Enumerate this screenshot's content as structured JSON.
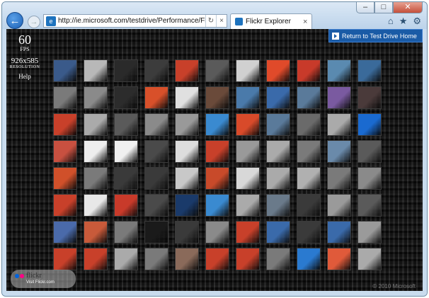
{
  "browser": {
    "address_url": "http://ie.microsoft.com/testdrive/Performance/FlickrExpl",
    "tab_title": "Flickr Explorer",
    "tab_close": "×",
    "back_glyph": "←",
    "forward_glyph": "→",
    "refresh_glyph": "↻",
    "stop_glyph": "×",
    "window_controls": {
      "minimize": "–",
      "maximize": "□",
      "close": "✕"
    },
    "toolbar_icons": [
      "home-icon",
      "favorites-star-icon",
      "tools-gear-icon"
    ],
    "toolbar_glyphs": {
      "home": "⌂",
      "star": "★",
      "gear": "⚙"
    }
  },
  "stats": {
    "fps_value": "60",
    "fps_label": "FPS",
    "resolution_value": "926x585",
    "resolution_label": "RESOLUTION",
    "help_label": "Help"
  },
  "return_button": {
    "label": "Return to Test Drive Home"
  },
  "footer": {
    "logo_text": "flickr",
    "visit_text": "Visit Flickr.com",
    "copyright": "© 2010 Microsoft"
  },
  "colors": {
    "accent_blue": "#1a5ba6",
    "flickr_blue": "#0063dc",
    "flickr_pink": "#ff0084",
    "background": "#0f0f0f"
  },
  "tiles": [
    [
      "#3a5a8a",
      "#b8b8b8",
      "#2a2a2a",
      "#3c3c3c",
      "#c8402a",
      "#5a5a5a",
      "#d0d0d0",
      "#e04a2a",
      "#c83a2a",
      "#5a8ab0",
      "#3a6a9a"
    ],
    [
      "#7a7a7a",
      "#8a8a8a",
      "#2c2c2c",
      "#d8502a",
      "#e0e0e0",
      "#6a4a3a",
      "#4a7aaa",
      "#3a6aaa",
      "#5a7a9a",
      "#7a5aa0",
      "#4a3a3a"
    ],
    [
      "#c8402a",
      "#aaaaaa",
      "#5a5a5a",
      "#8a8a8a",
      "#999999",
      "#3a8ad0",
      "#d84a2a",
      "#5a7a9a",
      "#6a6a6a",
      "#aaaaaa",
      "#1a6ad0"
    ],
    [
      "#c85040",
      "#eeeeee",
      "#f0f0f0",
      "#4a4a4a",
      "#dddddd",
      "#c8402a",
      "#999999",
      "#aaaaaa",
      "#7a7a7a",
      "#6a8aaa",
      "#5a5a5a"
    ],
    [
      "#d0502a",
      "#7a7a7a",
      "#3a3a3a",
      "#3a3a3a",
      "#c8c8c8",
      "#c84a2a",
      "#d8d8d8",
      "#aaaaaa",
      "#b0b0b0",
      "#7a7a7a",
      "#8a8a8a"
    ],
    [
      "#c8402a",
      "#e8e8e8",
      "#c83a2a",
      "#4a4a4a",
      "#1a3a6a",
      "#3a8ad0",
      "#aaaaaa",
      "#6a7a8a",
      "#3a3a3a",
      "#9a9a9a",
      "#5a5a5a"
    ],
    [
      "#4a6aaa",
      "#c85a3a",
      "#7a7a7a",
      "#1a1a1a",
      "#3a3a3a",
      "#8a8a8a",
      "#c8402a",
      "#3a6aaa",
      "#3a3a3a",
      "#3a6aaa",
      "#9a9a9a"
    ],
    [
      "#c8402a",
      "#c8402a",
      "#aaaaaa",
      "#7a7a7a",
      "#8a6a5a",
      "#c8402a",
      "#c8402a",
      "#7a7a7a",
      "#2a7ad0",
      "#e05a3a",
      "#aaaaaa"
    ]
  ]
}
